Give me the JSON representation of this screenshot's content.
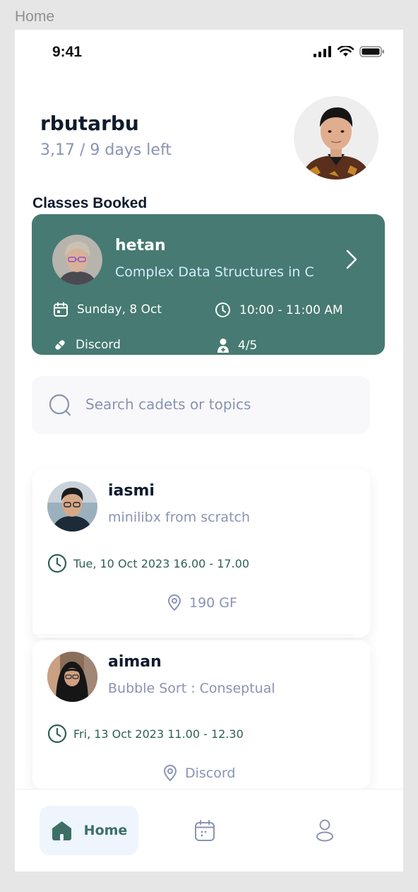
{
  "frame": {
    "label": "Home"
  },
  "status_bar": {
    "time": "9:41"
  },
  "user": {
    "name": "rbutarbu",
    "subtitle": "3,17 / 9 days left"
  },
  "sections": {
    "classes_booked": "Classes Booked"
  },
  "booked_class": {
    "name": "hetan",
    "topic": "Complex Data Structures in C",
    "date": "Sunday, 8 Oct",
    "time": "10:00 - 11:00 AM",
    "location": "Discord",
    "attendees": "4/5",
    "card_color": "#467a72"
  },
  "search": {
    "placeholder": "Search cadets or topics"
  },
  "classes": [
    {
      "name": "iasmi",
      "topic": "minilibx from scratch",
      "datetime": "Tue, 10 Oct 2023 16.00 - 17.00",
      "location": "190 GF"
    },
    {
      "name": "aiman",
      "topic": "Bubble Sort : Conseptual",
      "datetime": "Fri, 13 Oct 2023 11.00 - 12.30",
      "location": "Discord"
    }
  ],
  "nav": {
    "home_label": "Home",
    "active_color": "#3d6f67",
    "active_bg": "#eef5fc"
  },
  "icons": {
    "status": [
      "cellular-signal-icon",
      "wifi-icon",
      "battery-icon"
    ],
    "booked_meta": [
      "calendar-icon",
      "clock-icon",
      "link-icon",
      "person-add-icon"
    ],
    "nav": [
      "home-icon",
      "calendar-icon",
      "profile-icon"
    ]
  }
}
